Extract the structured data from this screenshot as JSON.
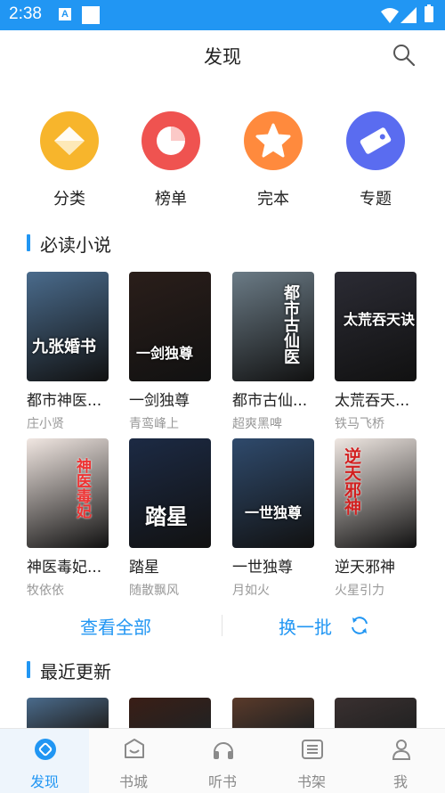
{
  "status_bar": {
    "time": "2:38",
    "app_badge": "A"
  },
  "header": {
    "title": "发现"
  },
  "categories": [
    {
      "label": "分类",
      "color": "#f7b52c",
      "icon": "diamond-icon"
    },
    {
      "label": "榜单",
      "color": "#ef5350",
      "icon": "moon-chart-icon"
    },
    {
      "label": "完本",
      "color": "#ff8a3d",
      "icon": "star-icon"
    },
    {
      "label": "专题",
      "color": "#5a6cf0",
      "icon": "tag-icon"
    }
  ],
  "must_read": {
    "title": "必读小说",
    "books": [
      {
        "title": "都市神医...",
        "author": "庄小贤",
        "cover_text": "九张婚书",
        "cover_color": "#4a6b8c"
      },
      {
        "title": "一剑独尊",
        "author": "青鸾峰上",
        "cover_text": "一剑独尊",
        "cover_color": "#2a1e1a"
      },
      {
        "title": "都市古仙...",
        "author": "超爽黑啤",
        "cover_text": "都市古仙医",
        "cover_color": "#6b7b86"
      },
      {
        "title": "太荒吞天...",
        "author": "铁马飞桥",
        "cover_text": "太荒吞天诀",
        "cover_color": "#2b2b34"
      },
      {
        "title": "神医毒妃...",
        "author": "牧依依",
        "cover_text": "神医毒妃",
        "cover_color": "#f1e7e2"
      },
      {
        "title": "踏星",
        "author": "随散飘风",
        "cover_text": "踏星",
        "cover_color": "#1c2a44"
      },
      {
        "title": "一世独尊",
        "author": "月如火",
        "cover_text": "一世独尊",
        "cover_color": "#2f4a6c"
      },
      {
        "title": "逆天邪神",
        "author": "火星引力",
        "cover_text": "逆天邪神",
        "cover_color": "#efe7e2"
      }
    ]
  },
  "actions": {
    "view_all": "查看全部",
    "refresh": "换一批"
  },
  "recent": {
    "title": "最近更新",
    "cover_colors": [
      "#4a6b8c",
      "#3a1e16",
      "#5a3a2a",
      "#3a3030"
    ]
  },
  "tabs": [
    {
      "label": "发现",
      "icon": "discover-icon",
      "active": true
    },
    {
      "label": "书城",
      "icon": "bookstore-icon",
      "active": false
    },
    {
      "label": "听书",
      "icon": "headphones-icon",
      "active": false
    },
    {
      "label": "书架",
      "icon": "bookshelf-icon",
      "active": false
    },
    {
      "label": "我",
      "icon": "profile-icon",
      "active": false
    }
  ],
  "colors": {
    "accent": "#2196f3",
    "status_bar": "#2196f3"
  }
}
